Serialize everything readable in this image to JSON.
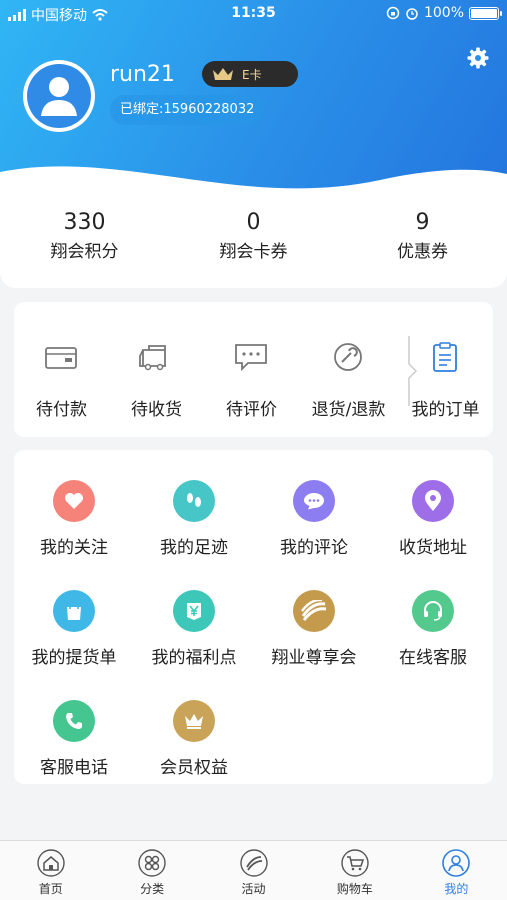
{
  "status_bar": {
    "carrier": "中国移动",
    "time": "11:35",
    "battery": "100%"
  },
  "profile": {
    "username": "run21",
    "card_label": "E卡",
    "bound_phone": "已绑定:15960228032"
  },
  "stats": [
    {
      "value": "330",
      "label": "翔会积分"
    },
    {
      "value": "0",
      "label": "翔会卡券"
    },
    {
      "value": "9",
      "label": "优惠券"
    }
  ],
  "orders": [
    {
      "label": "待付款",
      "icon": "wallet-icon"
    },
    {
      "label": "待收货",
      "icon": "truck-icon"
    },
    {
      "label": "待评价",
      "icon": "comment-icon"
    },
    {
      "label": "退货/退款",
      "icon": "refund-icon"
    },
    {
      "label": "我的订单",
      "icon": "order-list-icon"
    }
  ],
  "services": [
    {
      "label": "我的关注",
      "icon": "heart-icon",
      "color": "#f5837a"
    },
    {
      "label": "我的足迹",
      "icon": "footprint-icon",
      "color": "#46c6c6"
    },
    {
      "label": "我的评论",
      "icon": "chat-icon",
      "color": "#8c7ef0"
    },
    {
      "label": "收货地址",
      "icon": "location-icon",
      "color": "#9e6ee8"
    },
    {
      "label": "我的提货单",
      "icon": "bag-icon",
      "color": "#3fb8e8"
    },
    {
      "label": "我的福利点",
      "icon": "yen-icon",
      "color": "#3cc7b8"
    },
    {
      "label": "翔业尊享会",
      "icon": "brand-logo-icon",
      "color": "#c49a4c"
    },
    {
      "label": "在线客服",
      "icon": "headset-icon",
      "color": "#54c98e"
    },
    {
      "label": "客服电话",
      "icon": "phone-icon",
      "color": "#45c690"
    },
    {
      "label": "会员权益",
      "icon": "crown-icon",
      "color": "#c9a458"
    }
  ],
  "tabs": [
    {
      "label": "首页",
      "icon": "home-icon"
    },
    {
      "label": "分类",
      "icon": "category-icon"
    },
    {
      "label": "活动",
      "icon": "activity-icon"
    },
    {
      "label": "购物车",
      "icon": "cart-icon"
    },
    {
      "label": "我的",
      "icon": "profile-icon",
      "active": true
    }
  ],
  "colors": {
    "accent": "#2f7fe0",
    "header_start": "#30b6f5",
    "header_end": "#2374de"
  }
}
